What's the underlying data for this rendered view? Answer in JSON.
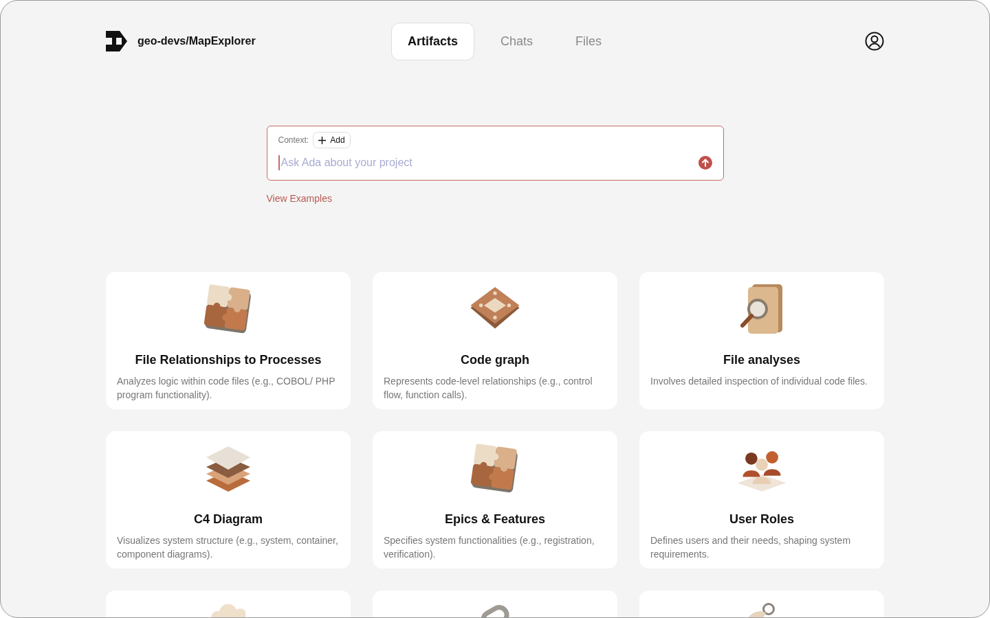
{
  "header": {
    "repo": "geo-devs/MapExplorer"
  },
  "tabs": [
    {
      "label": "Artifacts",
      "selected": true
    },
    {
      "label": "Chats",
      "selected": false
    },
    {
      "label": "Files",
      "selected": false
    }
  ],
  "prompt": {
    "context_label": "Context:",
    "add_button": "Add",
    "placeholder": "Ask Ada about your project"
  },
  "examples_link": "View Examples",
  "cards": [
    {
      "kind": "puzzle",
      "title": "File Relationships to Processes",
      "description": "Analyzes logic within code files (e.g., COBOL/ PHP program functionality)."
    },
    {
      "kind": "chip",
      "title": "Code graph",
      "description": "Represents code-level relationships (e.g., control flow, function calls)."
    },
    {
      "kind": "folder",
      "title": "File analyses",
      "description": "Involves detailed inspection of individual code files."
    },
    {
      "kind": "stack",
      "title": "C4 Diagram",
      "description": "Visualizes system structure (e.g., system, container, component diagrams)."
    },
    {
      "kind": "puzzle",
      "title": "Epics & Features",
      "description": "Specifies system functionalities (e.g., registration, verification)."
    },
    {
      "kind": "people",
      "title": "User Roles",
      "description": "Defines users and their needs, shaping system requirements."
    },
    {
      "kind": "cloud"
    },
    {
      "kind": "link"
    },
    {
      "kind": "key"
    }
  ]
}
